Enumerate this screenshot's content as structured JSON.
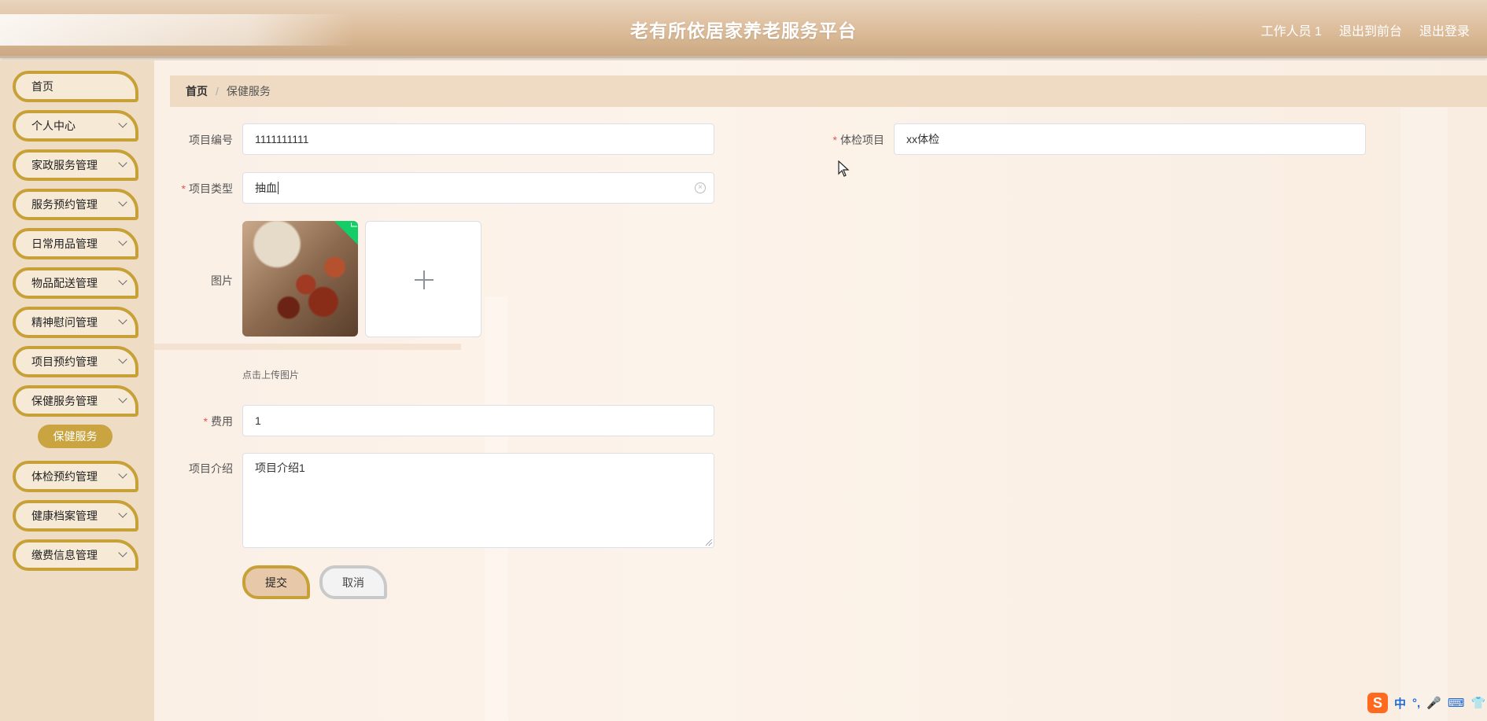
{
  "header": {
    "title": "老有所依居家养老服务平台",
    "user": "工作人员 1",
    "to_front": "退出到前台",
    "logout": "退出登录"
  },
  "sidebar": {
    "items": [
      {
        "label": "首页",
        "has_children": false
      },
      {
        "label": "个人中心",
        "has_children": true
      },
      {
        "label": "家政服务管理",
        "has_children": true
      },
      {
        "label": "服务预约管理",
        "has_children": true
      },
      {
        "label": "日常用品管理",
        "has_children": true
      },
      {
        "label": "物品配送管理",
        "has_children": true
      },
      {
        "label": "精神慰问管理",
        "has_children": true
      },
      {
        "label": "项目预约管理",
        "has_children": true
      },
      {
        "label": "保健服务管理",
        "has_children": true
      },
      {
        "label": "体检预约管理",
        "has_children": true
      },
      {
        "label": "健康档案管理",
        "has_children": true
      },
      {
        "label": "缴费信息管理",
        "has_children": true
      }
    ],
    "active_sub": "保健服务"
  },
  "breadcrumb": {
    "home": "首页",
    "sep": "/",
    "current": "保健服务"
  },
  "form": {
    "code": {
      "label": "项目编号",
      "value": "1111111111"
    },
    "exam": {
      "label": "体检项目",
      "value": "xx体检"
    },
    "type": {
      "label": "项目类型",
      "value": "抽血"
    },
    "image": {
      "label": "图片",
      "hint": "点击上传图片"
    },
    "fee": {
      "label": "费用",
      "value": "1"
    },
    "intro": {
      "label": "项目介绍",
      "value": "项目介绍1"
    },
    "submit": "提交",
    "cancel": "取消",
    "required_mark": "*"
  },
  "ime": {
    "logo": "S",
    "mode": "中",
    "punct": "°,"
  },
  "colors": {
    "accent": "#c7a138",
    "sidebar_bg": "#efdcc4",
    "active_sub_bg": "#c9a441",
    "required": "#e45555"
  }
}
